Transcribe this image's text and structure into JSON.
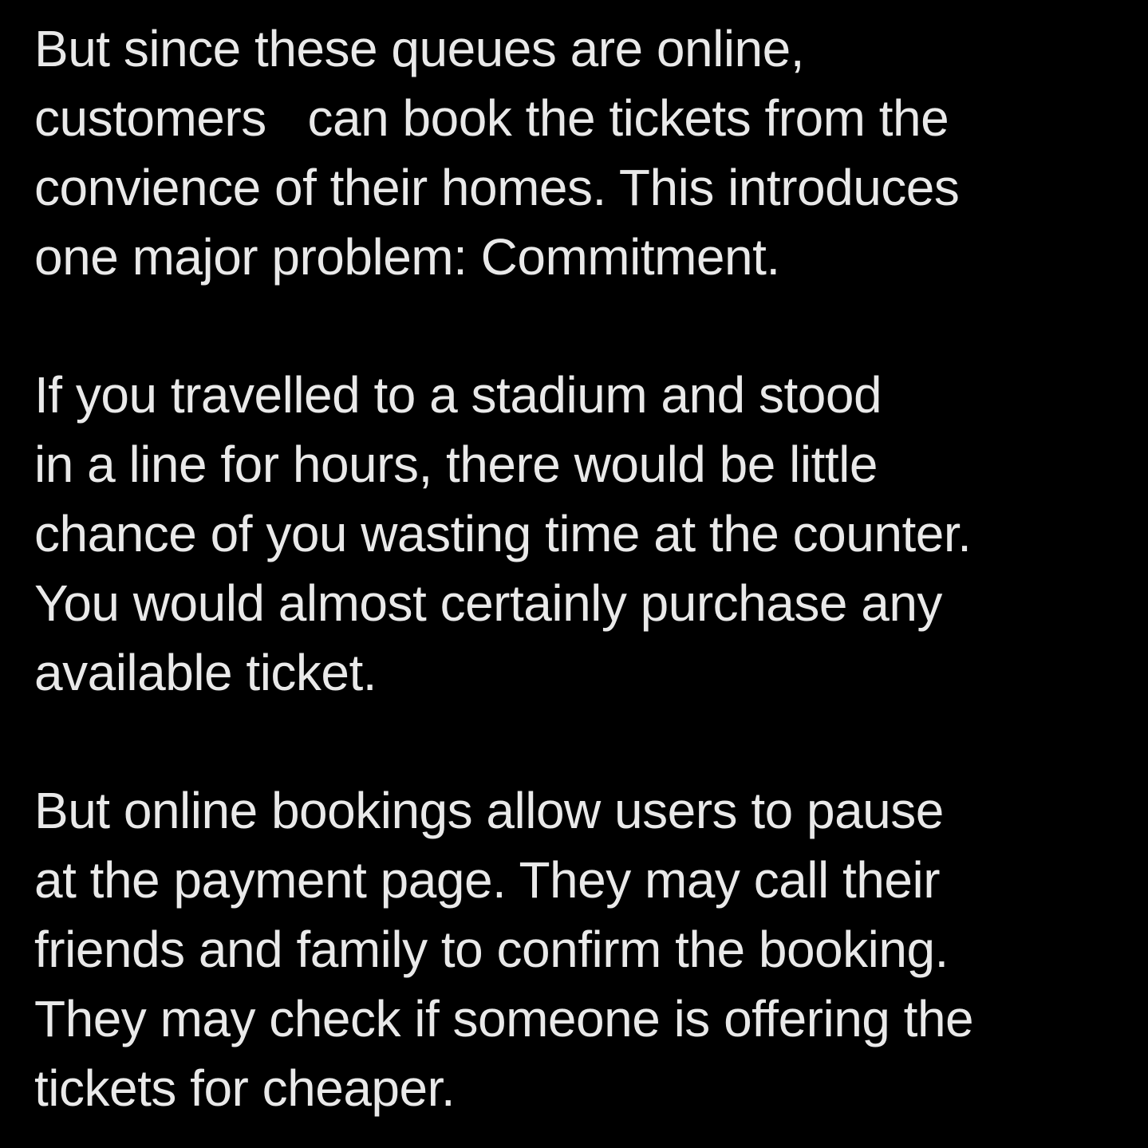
{
  "paragraphs": [
    {
      "lines": [
        "But since these queues are online,",
        "customers   can book the tickets from the",
        "convience of their homes. This introduces",
        "one major problem: Commitment."
      ]
    },
    {
      "lines": [
        "If you travelled to a stadium and stood",
        "in a line for hours, there would be little",
        "chance of you wasting time at the counter.",
        "You would almost certainly purchase any",
        "available ticket."
      ]
    },
    {
      "lines": [
        "But online bookings allow users to pause",
        "at the payment page. They may call their",
        "friends and family to confirm the booking.",
        "They may check if someone is offering the",
        "tickets for cheaper."
      ]
    }
  ]
}
